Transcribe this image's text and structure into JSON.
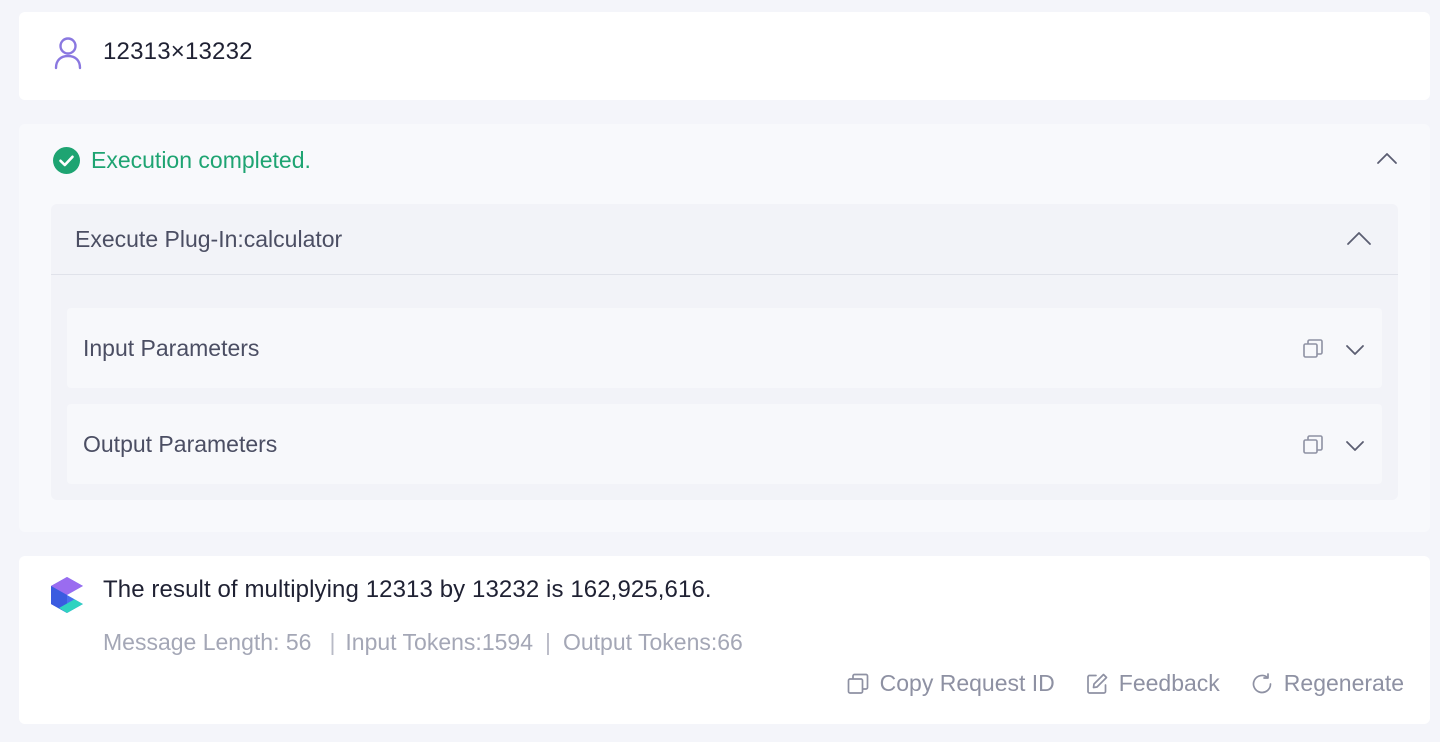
{
  "user_message": {
    "text": "12313×13232",
    "icon": "user-icon"
  },
  "execution": {
    "status_text": "Execution completed.",
    "status_icon": "check-circle-icon",
    "status_color": "#1ea472",
    "plugin": {
      "title": "Execute Plug-In:calculator",
      "sections": [
        {
          "label": "Input Parameters"
        },
        {
          "label": "Output Parameters"
        }
      ]
    }
  },
  "assistant_message": {
    "text": "The result of multiplying 12313 by 13232 is 162,925,616.",
    "meta": {
      "message_length": "Message Length: 56",
      "input_tokens": "Input Tokens:1594",
      "output_tokens": "Output Tokens:66",
      "separator": "|"
    },
    "actions": {
      "copy_request_id": "Copy Request ID",
      "feedback": "Feedback",
      "regenerate": "Regenerate"
    }
  },
  "colors": {
    "accent_purple": "#7b6cd9",
    "success_green": "#1ea472",
    "muted_text": "#a4a7b6"
  }
}
